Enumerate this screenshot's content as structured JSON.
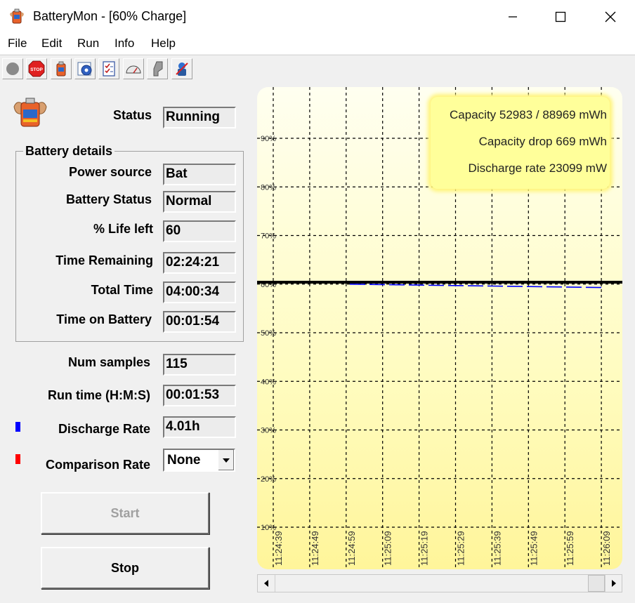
{
  "window": {
    "title": "BatteryMon - [60% Charge]"
  },
  "menu": [
    "File",
    "Edit",
    "Run",
    "Info",
    "Help"
  ],
  "toolbar": {
    "icons": [
      "record-icon",
      "stop-sign-icon",
      "battery-icon",
      "settings-gear-icon",
      "checklist-icon",
      "gauge-icon",
      "plug-icon",
      "debug-icon"
    ]
  },
  "status": {
    "label": "Status",
    "value": "Running"
  },
  "battery_details": {
    "title": "Battery details",
    "rows": [
      {
        "label": "Power source",
        "value": "Bat"
      },
      {
        "label": "Battery Status",
        "value": "Normal"
      },
      {
        "label": "% Life left",
        "value": "60"
      },
      {
        "label": "Time Remaining",
        "value": "02:24:21"
      },
      {
        "label": "Total Time",
        "value": "04:00:34"
      },
      {
        "label": "Time on Battery",
        "value": "00:01:54"
      }
    ]
  },
  "stats": {
    "num_samples": {
      "label": "Num samples",
      "value": "115"
    },
    "run_time": {
      "label": "Run time (H:M:S)",
      "value": "00:01:53"
    },
    "discharge": {
      "label": "Discharge Rate",
      "value": "4.01h",
      "color": "#0000ff"
    },
    "comparison": {
      "label": "Comparison Rate",
      "value": "None",
      "color": "#ff0000"
    }
  },
  "buttons": {
    "start": "Start",
    "stop": "Stop"
  },
  "chart_legend": {
    "capacity": "Capacity 52983 / 88969 mWh",
    "capacity_drop": "Capacity drop 669 mWh",
    "discharge_rate": "Discharge rate 23099 mW"
  },
  "chart_data": {
    "type": "line",
    "y_ticks": [
      "90%",
      "80%",
      "70%",
      "60%",
      "50%",
      "40%",
      "30%",
      "20%",
      "10%"
    ],
    "x_ticks": [
      "11:24:39",
      "11:24:49",
      "11:24:59",
      "11:25:09",
      "11:25:19",
      "11:25:29",
      "11:25:39",
      "11:25:49",
      "11:25:59",
      "11:26:09"
    ],
    "ylim": [
      5,
      100
    ],
    "grid": true,
    "series": [
      {
        "color": "#000000",
        "x": [
          "11:24:39",
          "11:26:09"
        ],
        "y": [
          60.4,
          60.4
        ]
      },
      {
        "color": "#0000ff",
        "x": [
          "11:25:00",
          "11:25:09",
          "11:25:19",
          "11:25:29",
          "11:25:39",
          "11:25:49",
          "11:25:59",
          "11:26:09"
        ],
        "y": [
          60.0,
          59.9,
          59.8,
          59.7,
          59.6,
          59.5,
          59.4,
          59.3
        ]
      }
    ]
  }
}
